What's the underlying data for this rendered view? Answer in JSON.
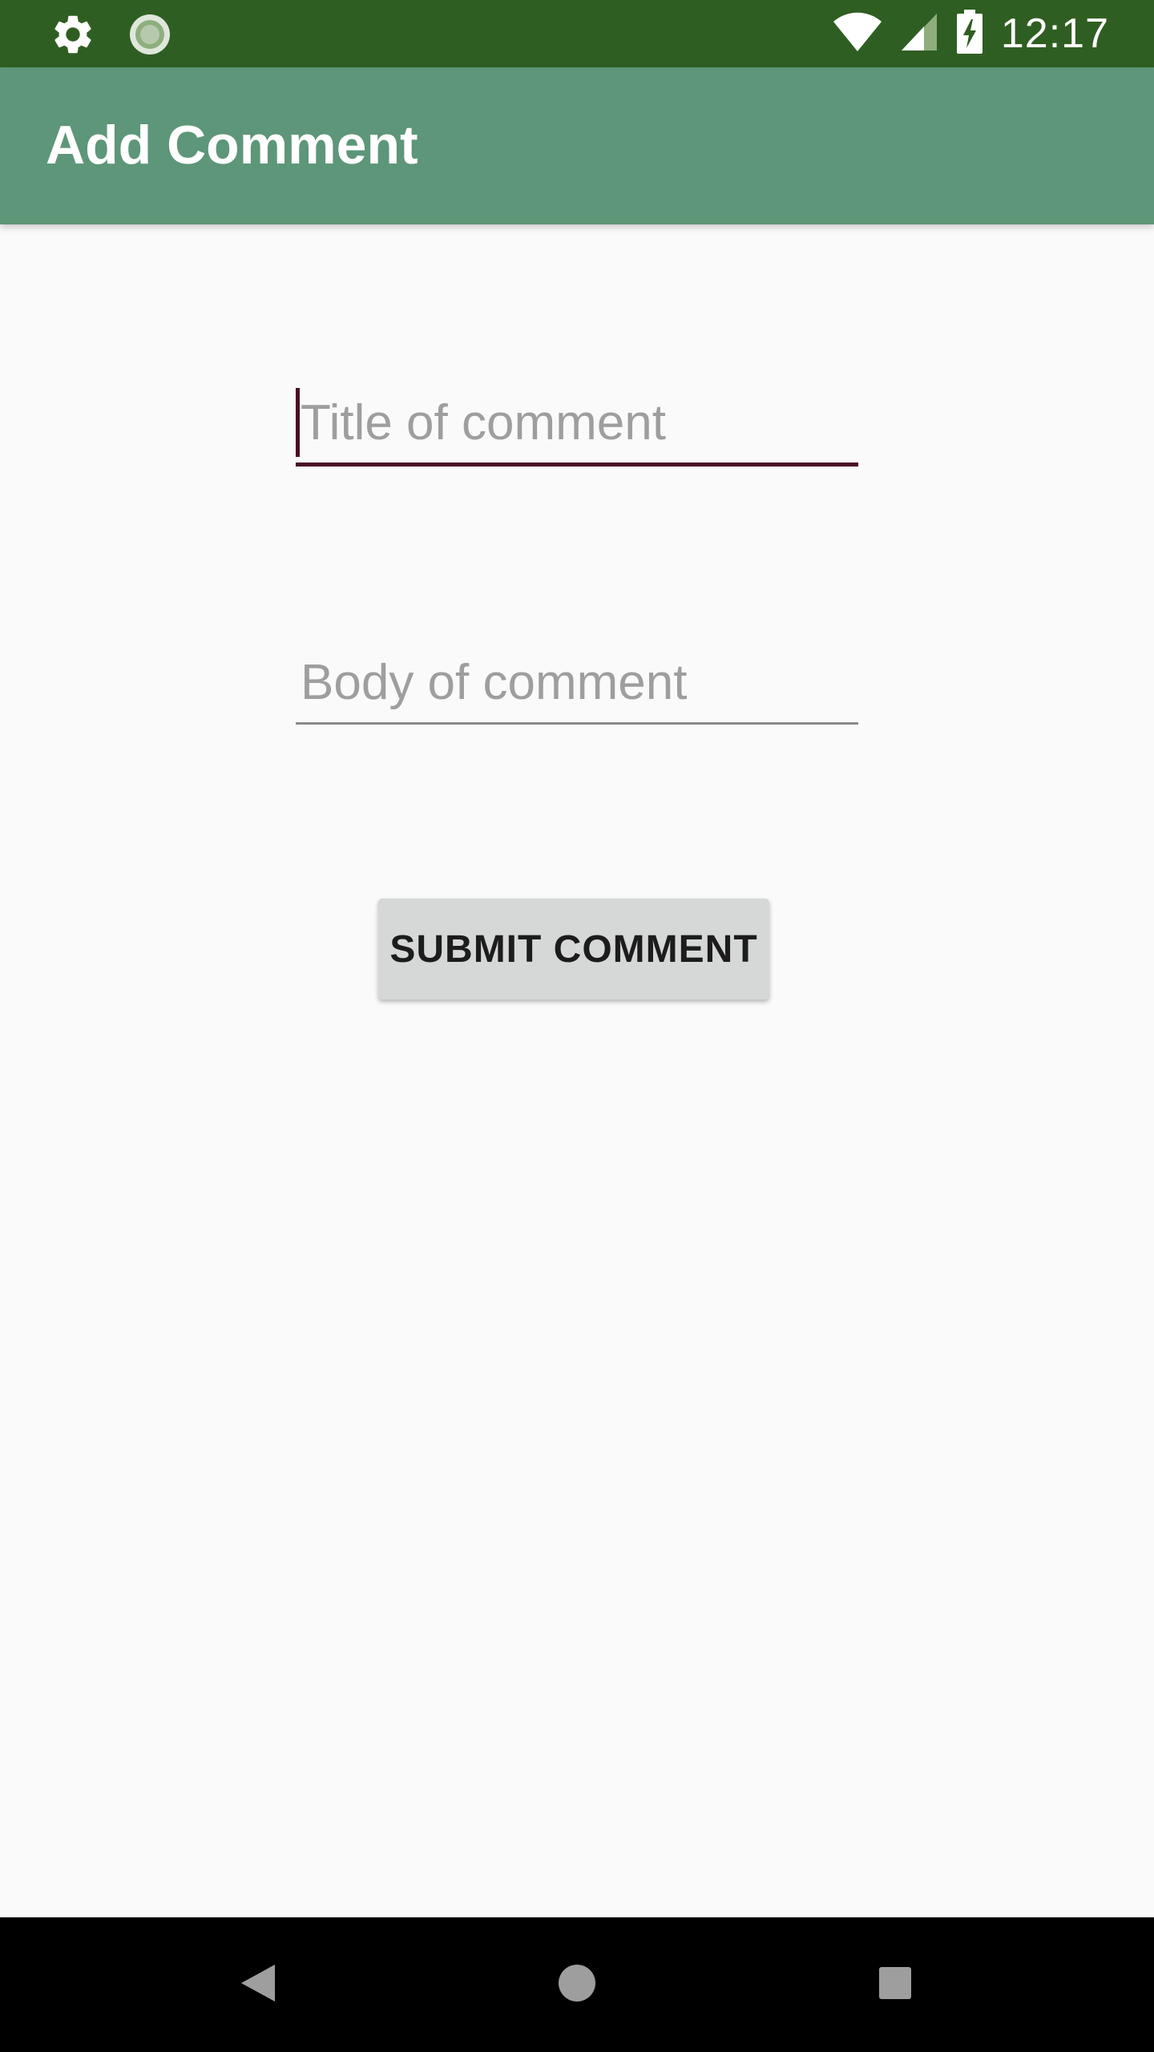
{
  "status_bar": {
    "time": "12:17",
    "left_icons": [
      "gear-icon",
      "loading-spinner-icon"
    ],
    "right_icons": [
      "wifi-icon",
      "cell-signal-icon",
      "battery-charging-icon"
    ]
  },
  "app_bar": {
    "title": "Add Comment"
  },
  "form": {
    "title_field": {
      "placeholder": "Title of comment",
      "value": ""
    },
    "body_field": {
      "placeholder": "Body of comment",
      "value": ""
    },
    "submit_label": "SUBMIT COMMENT"
  },
  "nav_bar": {
    "buttons": [
      "back-icon",
      "home-icon",
      "recents-icon"
    ]
  },
  "colors": {
    "status_bar": "#2f5e22",
    "app_bar": "#5d9678",
    "accent": "#4a0e24",
    "background": "#fafafa",
    "button": "#d6d7d7",
    "nav_bar": "#000000"
  }
}
